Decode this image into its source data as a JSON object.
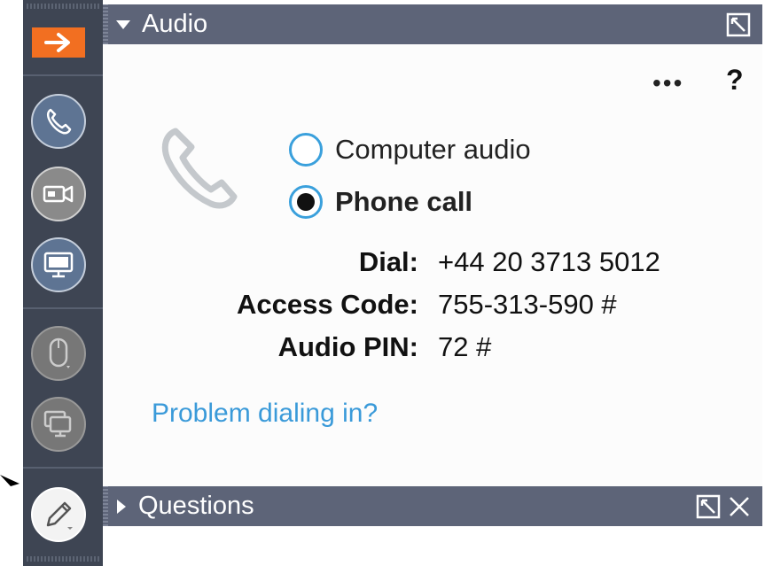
{
  "toolbar": {
    "items": [
      {
        "icon": "arrow-right-icon"
      },
      {
        "icon": "phone-icon"
      },
      {
        "icon": "webcam-icon"
      },
      {
        "icon": "screen-icon"
      },
      {
        "icon": "mouse-icon"
      },
      {
        "icon": "screens-icon"
      },
      {
        "icon": "pencil-icon"
      }
    ],
    "accent": "#f26f21"
  },
  "audio_panel": {
    "title": "Audio",
    "menu_label": "•••",
    "help_label": "?",
    "options": [
      {
        "label": "Computer audio",
        "selected": false
      },
      {
        "label": "Phone call",
        "selected": true
      }
    ],
    "details": [
      {
        "label": "Dial:",
        "value": "+44 20 3713 5012"
      },
      {
        "label": "Access Code:",
        "value": "755-313-590 #"
      },
      {
        "label": "Audio PIN:",
        "value": "72 #"
      }
    ],
    "link": "Problem dialing in?",
    "link_color": "#3a9ad9"
  },
  "questions_panel": {
    "title": "Questions"
  },
  "colors": {
    "header_bg": "#5d6478",
    "toolbar_bg": "#3e4553",
    "radio_accent": "#3aa0dc"
  }
}
